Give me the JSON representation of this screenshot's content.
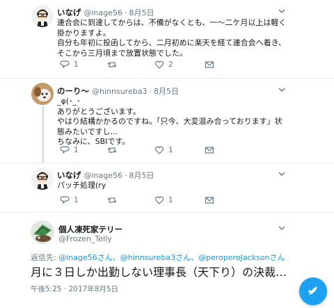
{
  "tweets": [
    {
      "name": "いなげ",
      "handle": "@inage56",
      "date": "8月5日",
      "text": "連合会に到達してからは、不備がなくとも、一〜二ケ月以上は軽く掛かりますよ。\n自分も年初に投函してから、二月初めに楽天を経て連合会へ着き、そこから三月頃まで放置状態でした。",
      "reply_count": "1",
      "retweet_count": "",
      "like_count": "2"
    },
    {
      "name": "のーり〜",
      "handle": "@hinnsureba3",
      "date": "8月5日",
      "text": "_φ(･_･\nありがとうございます。\nやはり結構かかるのですね。「只今、大変混み合っております」状態みたいですし…\nちなみに、SBIです。",
      "reply_count": "1",
      "retweet_count": "",
      "like_count": "1"
    },
    {
      "name": "いなげ",
      "handle": "@inage56",
      "date": "8月5日",
      "text": "パッチ処理(ry",
      "reply_count": "1",
      "retweet_count": "",
      "like_count": "1"
    }
  ],
  "main_tweet": {
    "name": "個人凍死家テリー",
    "handle": "@Frozen_Telly",
    "replying_prefix": "返信先: ",
    "replying_to": "@inage56さん、@hinnsureba3さん、@peroperoJacksonさん",
    "text": "月に３日しか出勤しない理事長（天下り）の決裁…",
    "timestamp": "午後5:25 · 2017年8月5日"
  },
  "icons": {
    "reply": "reply-icon",
    "retweet": "retweet-icon",
    "like": "heart-icon",
    "dm": "envelope-icon",
    "compose": "compose-tweet-icon"
  },
  "colors": {
    "accent": "#1da1f2",
    "link": "#1b95e0",
    "muted": "#657786"
  }
}
